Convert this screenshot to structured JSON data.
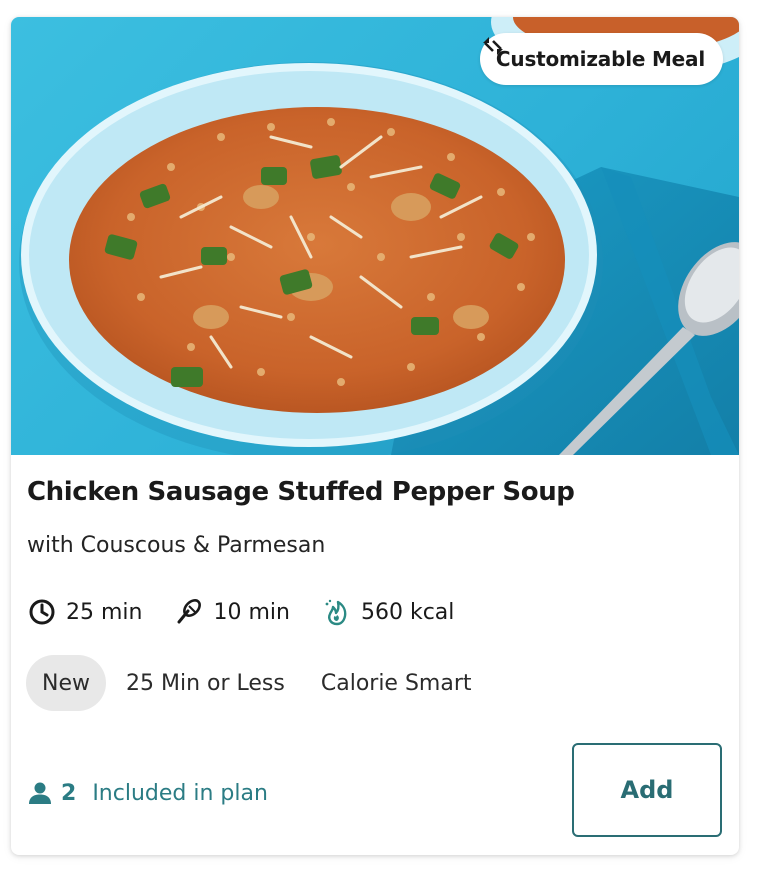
{
  "badge": {
    "label": "Customizable Meal",
    "icon": "swap-arrows-icon"
  },
  "recipe": {
    "title": "Chicken Sausage Stuffed Pepper Soup",
    "subtitle": "with Couscous & Parmesan"
  },
  "meta": {
    "total_time": "25 min",
    "prep_time": "10 min",
    "calories": "560 kcal"
  },
  "tags": [
    "New",
    "25 Min or Less",
    "Calorie Smart"
  ],
  "plan": {
    "servings": "2",
    "label": "Included in plan"
  },
  "actions": {
    "add_label": "Add"
  },
  "colors": {
    "accent": "#2a6d74",
    "plan_text": "#2b7c84",
    "tag_pill_bg": "#e8e8e8",
    "photo_bg": "#33b7dc",
    "calorie_icon": "#2b8a84"
  }
}
